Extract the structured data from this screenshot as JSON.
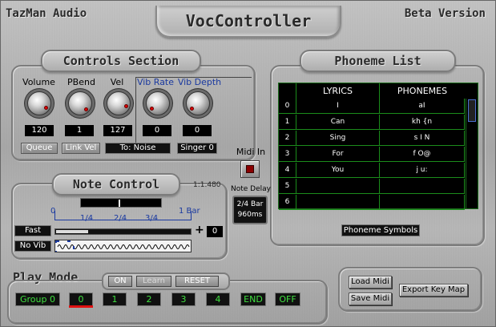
{
  "header": {
    "brand": "TazMan Audio",
    "title": "VocController",
    "version": "Beta Version"
  },
  "controls": {
    "title": "Controls Section",
    "knobs": [
      {
        "label": "Volume",
        "value": "120",
        "blue": false
      },
      {
        "label": "PBend",
        "value": "1",
        "blue": false
      },
      {
        "label": "Vel",
        "value": "127",
        "blue": false
      },
      {
        "label": "Vib Rate",
        "value": "0",
        "blue": true
      },
      {
        "label": "Vib Depth",
        "value": "0",
        "blue": true
      }
    ],
    "queue_label": "Queue",
    "link_vel_label": "Link Vel",
    "to_noise_label": "To: Noise",
    "singer_label": "Singer 0"
  },
  "phoneme": {
    "title": "Phoneme List",
    "col_lyrics": "LYRICS",
    "col_phonemes": "PHONEMES",
    "rows": [
      {
        "idx": "0",
        "lyric": "I",
        "phon": "aI"
      },
      {
        "idx": "1",
        "lyric": "Can",
        "phon": "kh {n"
      },
      {
        "idx": "2",
        "lyric": "Sing",
        "phon": "s I N"
      },
      {
        "idx": "3",
        "lyric": "For",
        "phon": "f O@"
      },
      {
        "idx": "4",
        "lyric": "You",
        "phon": "j u:"
      },
      {
        "idx": "5",
        "lyric": "",
        "phon": ""
      },
      {
        "idx": "6",
        "lyric": "",
        "phon": ""
      }
    ],
    "symbols_button": "Phoneme Symbols"
  },
  "midi_in": {
    "label": "Midi In"
  },
  "note_delay": {
    "label": "Note Delay",
    "value_line1": "2/4 Bar",
    "value_line2": "960ms"
  },
  "note_control": {
    "title": "Note Control",
    "ratio": "1:1.480",
    "ruler": [
      "0",
      "1/4",
      "2/4",
      "3/4",
      "1 Bar"
    ],
    "fast_label": "Fast",
    "no_vib_label": "No Vib",
    "plus_label": "+",
    "offset_value": "0"
  },
  "play_mode": {
    "title": "Play Mode",
    "on_label": "ON",
    "learn_label": "Learn",
    "reset_label": "RESET",
    "group_label": "Group 0",
    "slots": [
      "0",
      "1",
      "2",
      "3",
      "4"
    ],
    "end_label": "END",
    "off_label": "OFF"
  },
  "midi_files": {
    "load_label": "Load Midi",
    "save_label": "Save Midi",
    "export_label": "Export Key Map"
  },
  "colors": {
    "accent_blue": "#1b3aa0",
    "led_green": "#3fe03f",
    "active_red": "#e01010"
  }
}
